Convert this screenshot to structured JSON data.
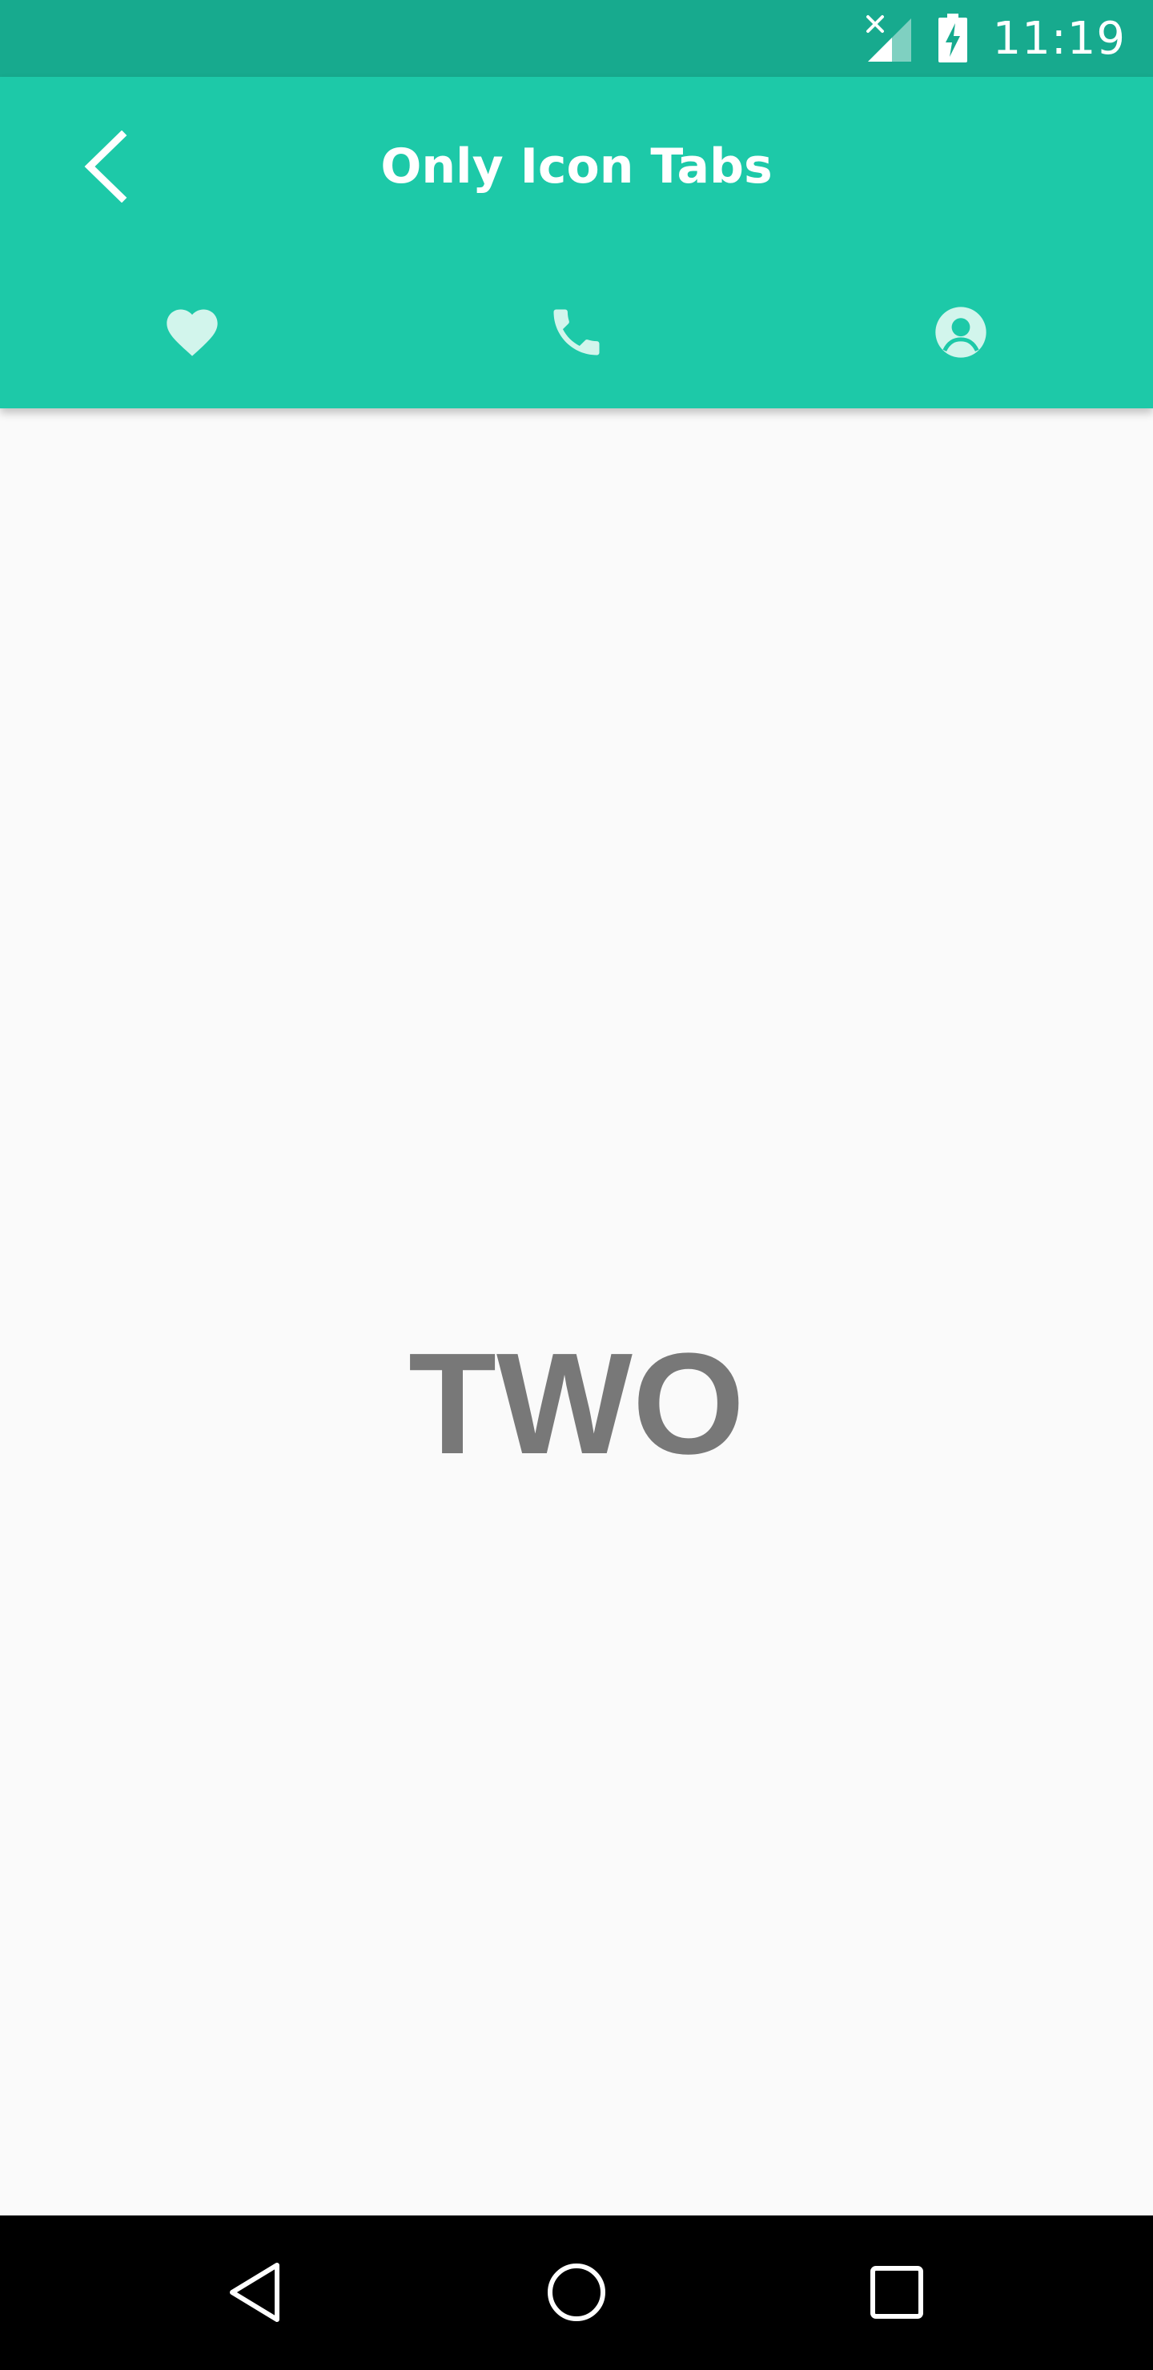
{
  "status_bar": {
    "time": "11:19",
    "icons": [
      "signal-no-data-icon",
      "battery-charging-icon"
    ]
  },
  "app_bar": {
    "title": "Only Icon Tabs",
    "back_icon": "arrow-back-icon",
    "tabs": [
      {
        "icon": "heart-icon",
        "selected": false
      },
      {
        "icon": "phone-icon",
        "selected": true
      },
      {
        "icon": "person-icon",
        "selected": false
      }
    ]
  },
  "content": {
    "label": "TWO"
  },
  "nav_bar": {
    "icons": [
      "back-triangle-icon",
      "home-circle-icon",
      "recents-square-icon"
    ]
  },
  "colors": {
    "status_bar": "#17aa8e",
    "app_bar": "#1dc9a8",
    "content_bg": "#fafafa",
    "content_text": "#787878",
    "nav_bar": "#000000",
    "tab_icon": "#d2f5ec"
  }
}
